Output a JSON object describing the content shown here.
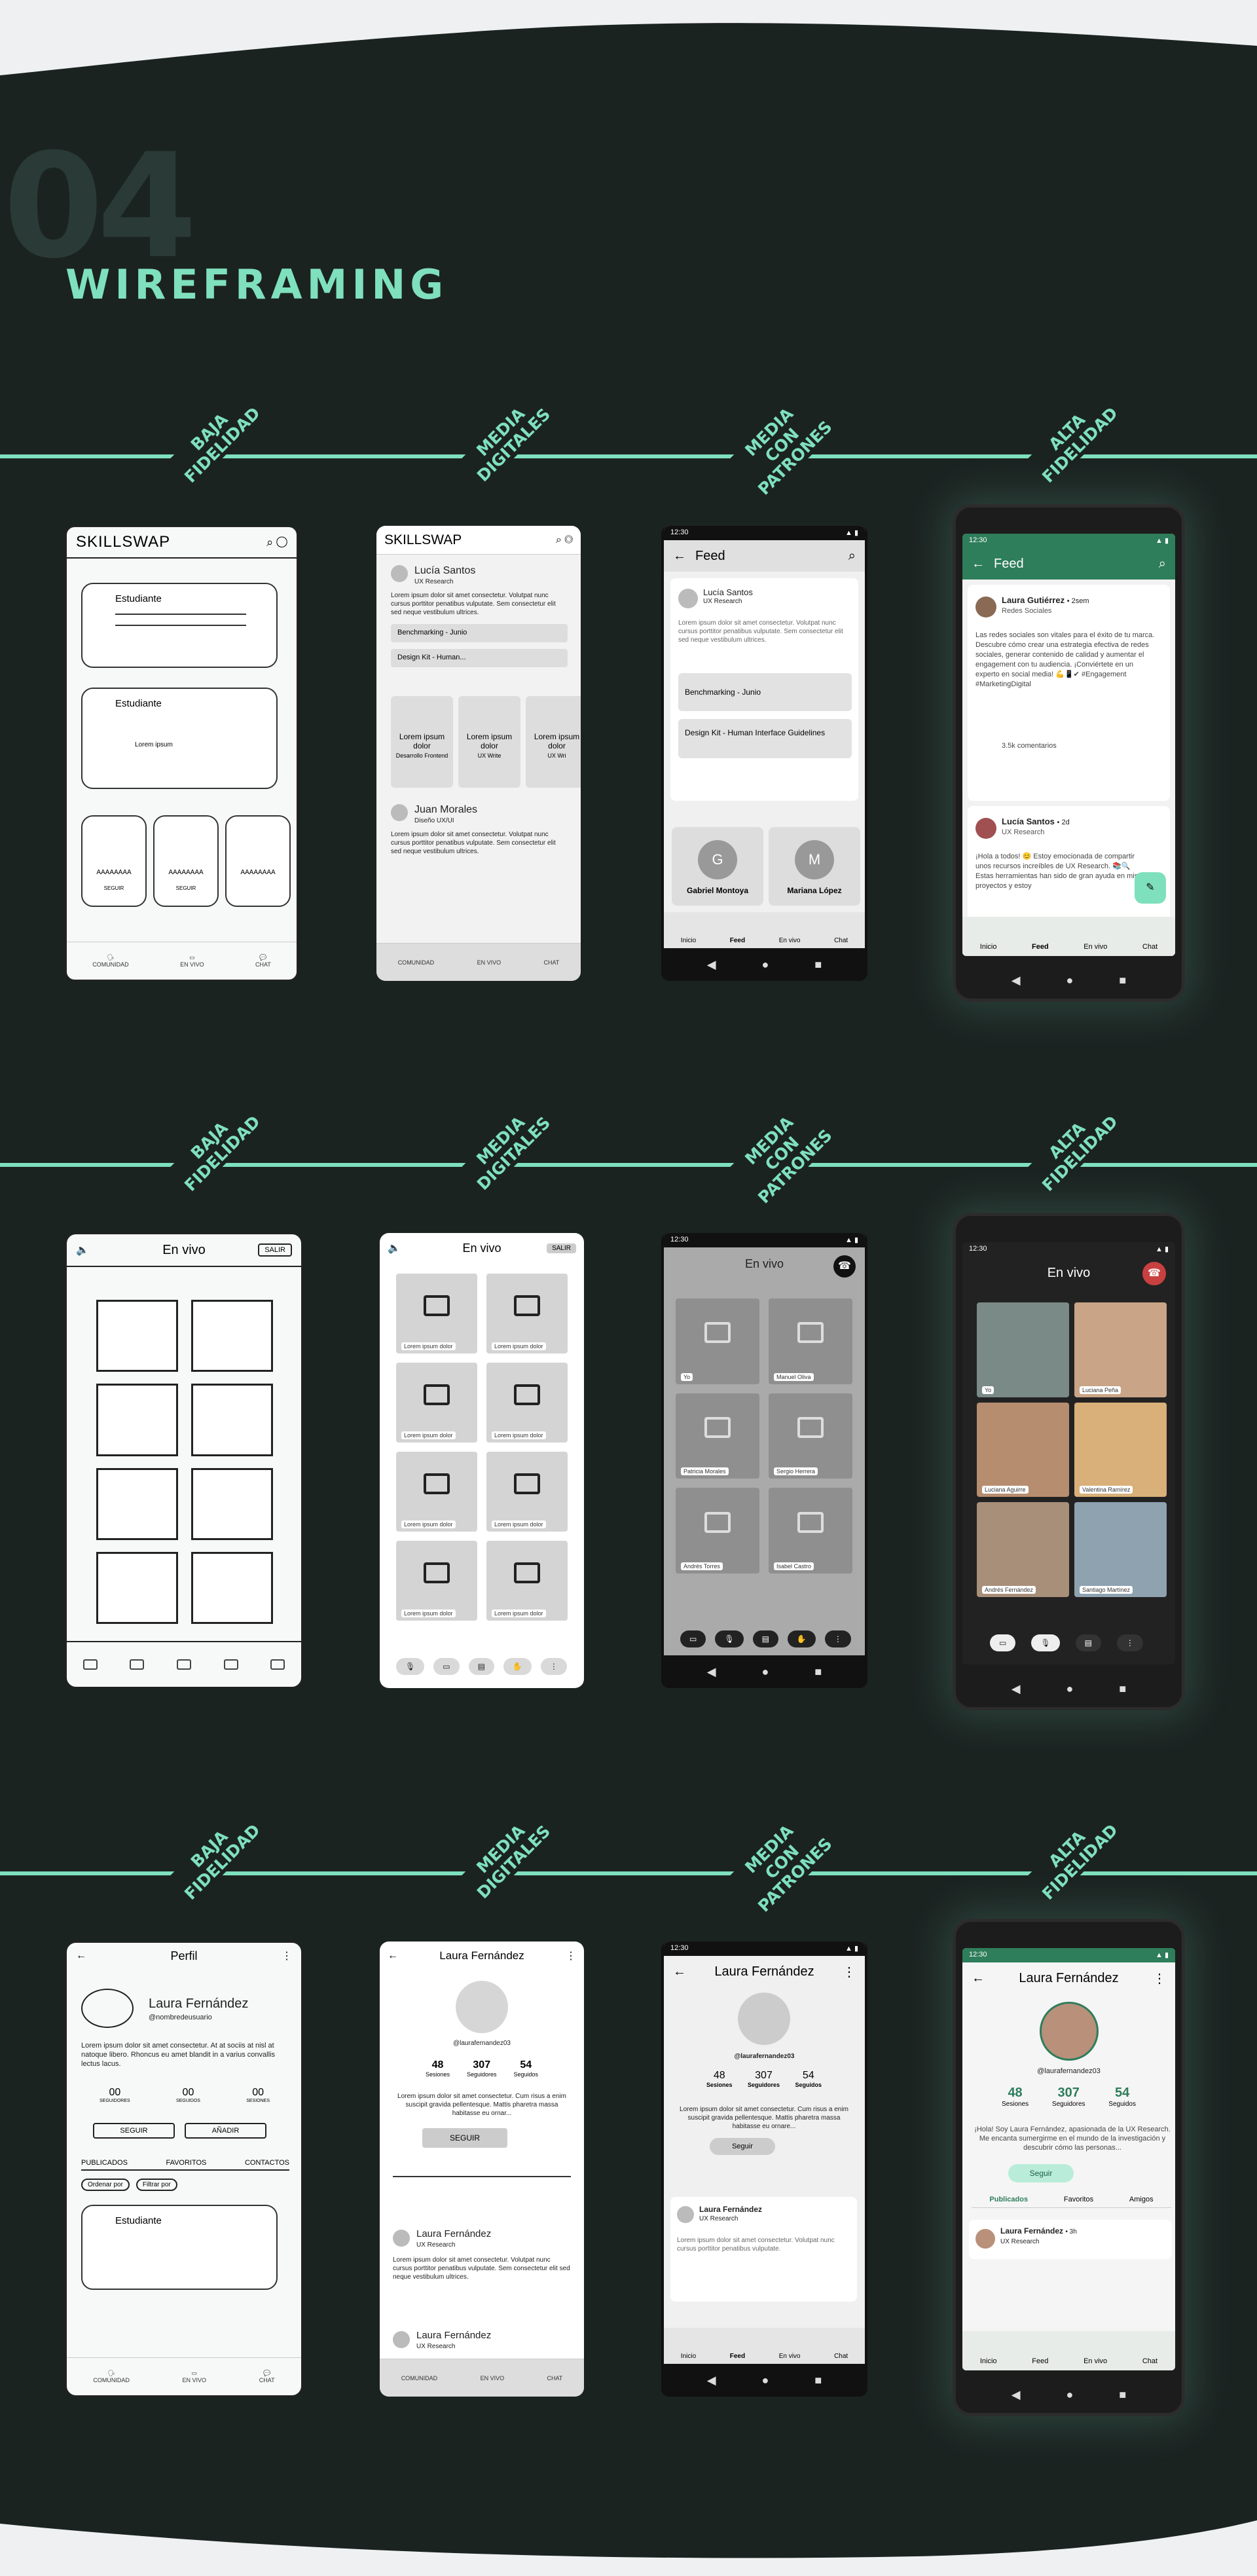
{
  "section": {
    "number": "04",
    "title": "WIREFRAMING"
  },
  "rows": [
    {
      "tags": [
        "BAJA\nFIDELIDAD",
        "MEDIA\nDIGITALES",
        "MEDIA CON\nPATRONES",
        "ALTA\nFIDELIDAD"
      ]
    },
    {
      "tags": [
        "BAJA\nFIDELIDAD",
        "MEDIA\nDIGITALES",
        "MEDIA CON\nPATRONES",
        "ALTA\nFIDELIDAD"
      ]
    },
    {
      "tags": [
        "BAJA\nFIDELIDAD",
        "MEDIA\nDIGITALES",
        "MEDIA CON\nPATRONES",
        "ALTA\nFIDELIDAD"
      ]
    }
  ],
  "feed": {
    "low": {
      "brand": "SKILLSWAP",
      "item1": "Estudiante",
      "item2": "Estudiante",
      "chip_text": "Lorem ipsum",
      "cards": [
        "AAAAAAAA",
        "AAAAAAAA",
        "AAAAAAAA"
      ],
      "card_btn": "SEGUIR",
      "nav": [
        "COMUNIDAD",
        "EN VIVO",
        "CHAT"
      ]
    },
    "mid": {
      "brand": "SKILLSWAP",
      "user1": "Lucía Santos",
      "role1": "UX Research",
      "body": "Lorem ipsum dolor sit amet consectetur. Volutpat nunc cursus porttitor penatibus vulputate. Sem consectetur elit sed neque vestibulum ultrices.",
      "link1": "Benchmarking - Junio",
      "link2": "Design Kit - Human...",
      "cards": [
        {
          "t": "Lorem ipsum dolor",
          "s": "Desarrollo Frontend"
        },
        {
          "t": "Lorem ipsum dolor",
          "s": "UX Write"
        },
        {
          "t": "Lorem ipsum dolor",
          "s": "UX Wri"
        }
      ],
      "user2": "Juan Morales",
      "role2": "Diseño UX/UI",
      "nav": [
        "COMUNIDAD",
        "EN VIVO",
        "CHAT"
      ]
    },
    "pat": {
      "time": "12:30",
      "title": "Feed",
      "user1": "Lucía Santos",
      "role1": "UX Research",
      "body": "Lorem ipsum dolor sit amet consectetur. Volutpat nunc cursus porttitor penatibus vulputate. Sem consectetur elit sed neque vestibulum ultrices.",
      "link1": "Benchmarking - Junio",
      "link2": "Design Kit - Human Interface Guidelines",
      "s1": "Gabriel Montoya",
      "s1i": "G",
      "s2": "Mariana López",
      "s2i": "M",
      "nav": [
        "Inicio",
        "Feed",
        "En vivo",
        "Chat"
      ]
    },
    "high": {
      "time": "12:30",
      "title": "Feed",
      "user1": "Laura Gutiérrez",
      "meta1": "• 2sem",
      "role1": "Redes Sociales",
      "body1": "Las redes sociales son vitales para el éxito de tu marca. Descubre cómo crear una estrategia efectiva de redes sociales, generar contenido de calidad y aumentar el engagement con tu audiencia. ¡Conviértete en un experto en social media! 💪📱✔ #Engagement #MarketingDigital",
      "comments": "3.5k comentarios",
      "user2": "Lucía Santos",
      "meta2": "• 2d",
      "role2": "UX Research",
      "body2": "¡Hola a todos! 😊 Estoy emocionada de compartir unos recursos increíbles de UX Research. 📚🔍 Estas herramientas han sido de gran ayuda en mis proyectos y estoy",
      "nav": [
        "Inicio",
        "Feed",
        "En vivo",
        "Chat"
      ]
    }
  },
  "live": {
    "low": {
      "title": "En vivo",
      "exit": "SALIR"
    },
    "mid": {
      "title": "En vivo",
      "exit": "SALIR",
      "cell": "Lorem ipsum dolor"
    },
    "pat": {
      "time": "12:30",
      "title": "En vivo",
      "names": [
        "Yo",
        "Manuel Oliva",
        "Patricia Morales",
        "Sergio Herrera",
        "Andrés Torres",
        "Isabel Castro"
      ]
    },
    "high": {
      "time": "12:30",
      "title": "En vivo",
      "names": [
        "Yo",
        "Luciana Peña",
        "Luciana Aguirre",
        "Valentina Ramírez",
        "Andrés Fernández",
        "Santiago Martínez"
      ]
    }
  },
  "profile": {
    "low": {
      "title": "Perfil",
      "name": "Laura Fernández",
      "handle": "@nombredeusuario",
      "bio": "Lorem ipsum dolor sit amet consectetur. At at sociis at nisl at natoque libero. Rhoncus eu amet blandit in a varius convallis lectus lacus.",
      "stats": [
        {
          "n": "00",
          "l": "SEGUIDORES"
        },
        {
          "n": "00",
          "l": "SEGUIDOS"
        },
        {
          "n": "00",
          "l": "SESIONES"
        }
      ],
      "b1": "SEGUIR",
      "b2": "AÑADIR",
      "tabs": [
        "PUBLICADOS",
        "FAVORITOS",
        "CONTACTOS"
      ],
      "f1": "Ordenar por",
      "f2": "Filtrar por",
      "item": "Estudiante",
      "nav": [
        "COMUNIDAD",
        "EN VIVO",
        "CHAT"
      ]
    },
    "mid": {
      "title": "Laura Fernández",
      "handle": "@laurafernandez03",
      "stats": [
        {
          "n": "48",
          "l": "Sesiones"
        },
        {
          "n": "307",
          "l": "Seguidores"
        },
        {
          "n": "54",
          "l": "Seguidos"
        }
      ],
      "bio": "Lorem ipsum dolor sit amet consectetur. Cum risus a enim suscipit gravida pellentesque. Mattis pharetra massa habitasse eu ornar...",
      "follow": "SEGUIR",
      "post_user": "Laura Fernández",
      "post_role": "UX Research",
      "post_body": "Lorem ipsum dolor sit amet consectetur. Volutpat nunc cursus porttitor penatibus vulputate. Sem consectetur elit sed neque vestibulum ultrices.",
      "nav": [
        "COMUNIDAD",
        "EN VIVO",
        "CHAT"
      ]
    },
    "pat": {
      "time": "12:30",
      "title": "Laura Fernández",
      "handle": "@laurafernandez03",
      "stats": [
        {
          "n": "48",
          "l": "Sesiones"
        },
        {
          "n": "307",
          "l": "Seguidores"
        },
        {
          "n": "54",
          "l": "Seguidos"
        }
      ],
      "bio": "Lorem ipsum dolor sit amet consectetur. Cum risus a enim suscipit gravida pellentesque. Mattis pharetra massa habitasse eu ornare...",
      "follow": "Seguir",
      "post_user": "Laura Fernández",
      "post_role": "UX Research",
      "post_body": "Lorem ipsum dolor sit amet consectetur. Volutpat nunc cursus porttitor penatibus vulputate.",
      "nav": [
        "Inicio",
        "Feed",
        "En vivo",
        "Chat"
      ]
    },
    "high": {
      "time": "12:30",
      "title": "Laura Fernández",
      "handle": "@laurafernandez03",
      "stats": [
        {
          "n": "48",
          "l": "Sesiones"
        },
        {
          "n": "307",
          "l": "Seguidores"
        },
        {
          "n": "54",
          "l": "Seguidos"
        }
      ],
      "bio": "¡Hola! Soy Laura Fernández, apasionada de la UX Research. Me encanta sumergirme en el mundo de la investigación y descubrir cómo las personas...",
      "follow": "Seguir",
      "tabs": [
        "Publicados",
        "Favoritos",
        "Amigos"
      ],
      "post_user": "Laura Fernández",
      "post_meta": "• 3h",
      "post_role": "UX Research",
      "nav": [
        "Inicio",
        "Feed",
        "En vivo",
        "Chat"
      ]
    }
  },
  "colors": {
    "bg": "#1b2321",
    "accent": "#7fe0be",
    "brand_green": "#2e7d5b"
  }
}
